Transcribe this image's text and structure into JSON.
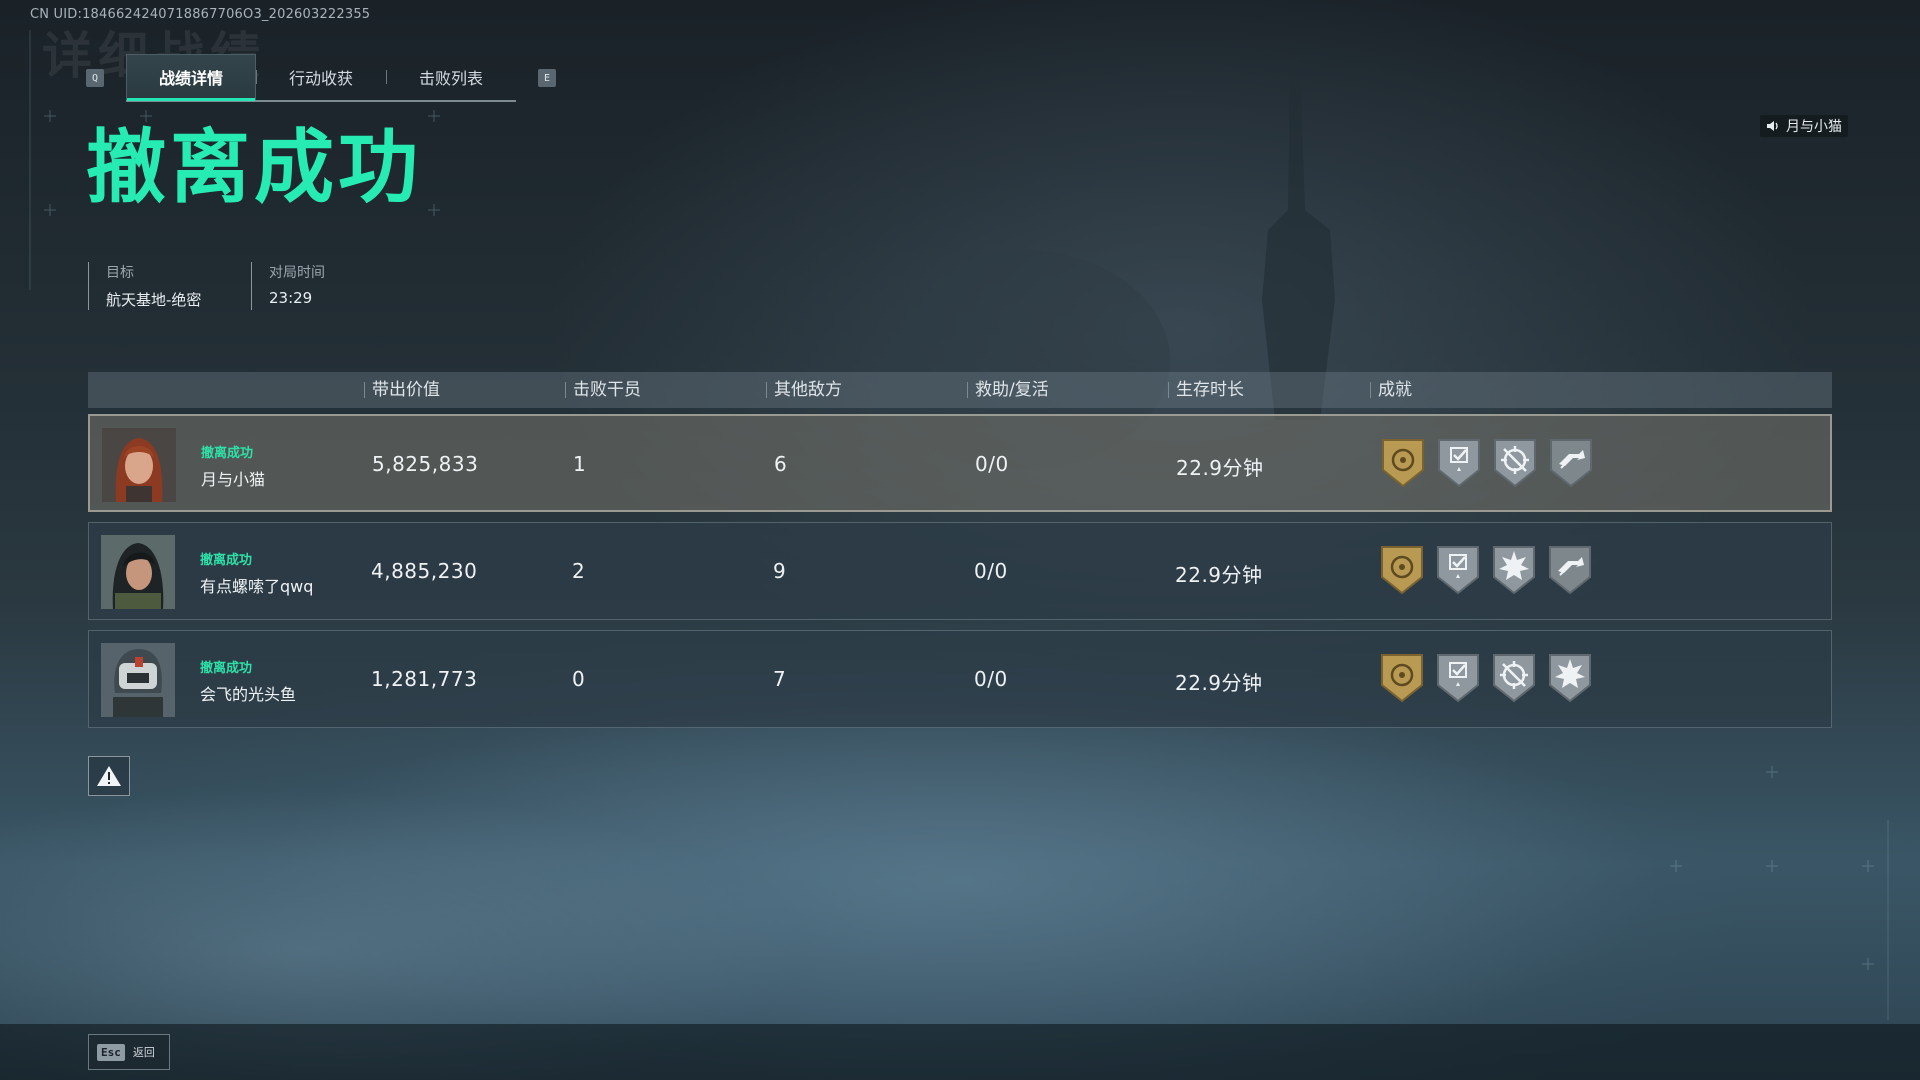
{
  "uid_text": "CN UID:1846624240718867706O3_202603222355",
  "ghost_title": "详细战绩",
  "tabs": {
    "prev_key": "Q",
    "next_key": "E",
    "items": [
      "战绩详情",
      "行动收获",
      "击败列表"
    ],
    "active_index": 0
  },
  "speaker": {
    "name": "月与小猫"
  },
  "result_title": "撤离成功",
  "meta": {
    "target_label": "目标",
    "target_value": "航天基地-绝密",
    "time_label": "对局时间",
    "time_value": "23:29"
  },
  "table": {
    "headers": [
      "带出价值",
      "击败干员",
      "其他敌方",
      "救助/复活",
      "生存时长",
      "成就"
    ],
    "rows": [
      {
        "status": "撤离成功",
        "name": "月与小猫",
        "value": "5,825,833",
        "kills": "1",
        "others": "6",
        "assists": "0/0",
        "survival": "22.9分钟",
        "highlight": true,
        "badges": [
          "gold-crest-badge",
          "check-star-badge",
          "target-cross-badge",
          "speed-arrow-badge"
        ]
      },
      {
        "status": "撤离成功",
        "name": "有点螺嗦了qwq",
        "value": "4,885,230",
        "kills": "2",
        "others": "9",
        "assists": "0/0",
        "survival": "22.9分钟",
        "highlight": false,
        "badges": [
          "gold-crest-badge",
          "check-star-badge",
          "burst-star-badge",
          "speed-arrow-badge"
        ]
      },
      {
        "status": "撤离成功",
        "name": "会飞的光头鱼",
        "value": "1,281,773",
        "kills": "0",
        "others": "7",
        "assists": "0/0",
        "survival": "22.9分钟",
        "highlight": false,
        "badges": [
          "gold-crest-badge",
          "check-star-badge",
          "target-cross-badge",
          "burst-star-badge"
        ]
      }
    ]
  },
  "footer": {
    "esc_key": "Esc",
    "back_label": "返回"
  },
  "colors": {
    "accent": "#26ecb4",
    "gold_badge": "#b89a52",
    "silver_badge": "#8e989e"
  }
}
